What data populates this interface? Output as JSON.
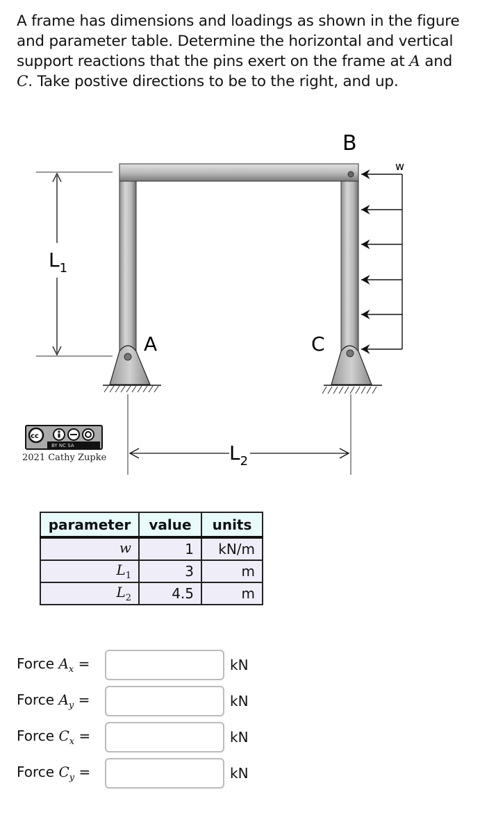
{
  "question": {
    "text_part1": "A frame has dimensions and loadings as shown in the figure and parameter table. Determine the horizontal and vertical support reactions that the pins exert on the frame at ",
    "var_a": "A",
    "text_and": " and ",
    "var_c": "C",
    "text_part2": ". Take postive directions to be to the right, and up."
  },
  "figure": {
    "labels": {
      "b": "B",
      "a": "A",
      "c": "C",
      "w": "w",
      "l1": "L",
      "l1_sub": "1",
      "l2": "L",
      "l2_sub": "2"
    },
    "license_badge": {
      "top": "cc",
      "bottom": "BY  NC  SA"
    },
    "credit": "2021 Cathy Zupke"
  },
  "parameter_table": {
    "headers": [
      "parameter",
      "value",
      "units"
    ],
    "rows": [
      {
        "param": "w",
        "param_sub": "",
        "value": "1",
        "units": "kN/m"
      },
      {
        "param": "L",
        "param_sub": "1",
        "value": "3",
        "units": "m"
      },
      {
        "param": "L",
        "param_sub": "2",
        "value": "4.5",
        "units": "m"
      }
    ]
  },
  "answers": [
    {
      "prefix": "Force ",
      "var": "A",
      "sub": "x",
      "eq": " =",
      "value": "",
      "unit": "kN"
    },
    {
      "prefix": "Force ",
      "var": "A",
      "sub": "y",
      "eq": " =",
      "value": "",
      "unit": "kN"
    },
    {
      "prefix": "Force ",
      "var": "C",
      "sub": "x",
      "eq": " =",
      "value": "",
      "unit": "kN"
    },
    {
      "prefix": "Force ",
      "var": "C",
      "sub": "y",
      "eq": " =",
      "value": "",
      "unit": "kN"
    }
  ]
}
